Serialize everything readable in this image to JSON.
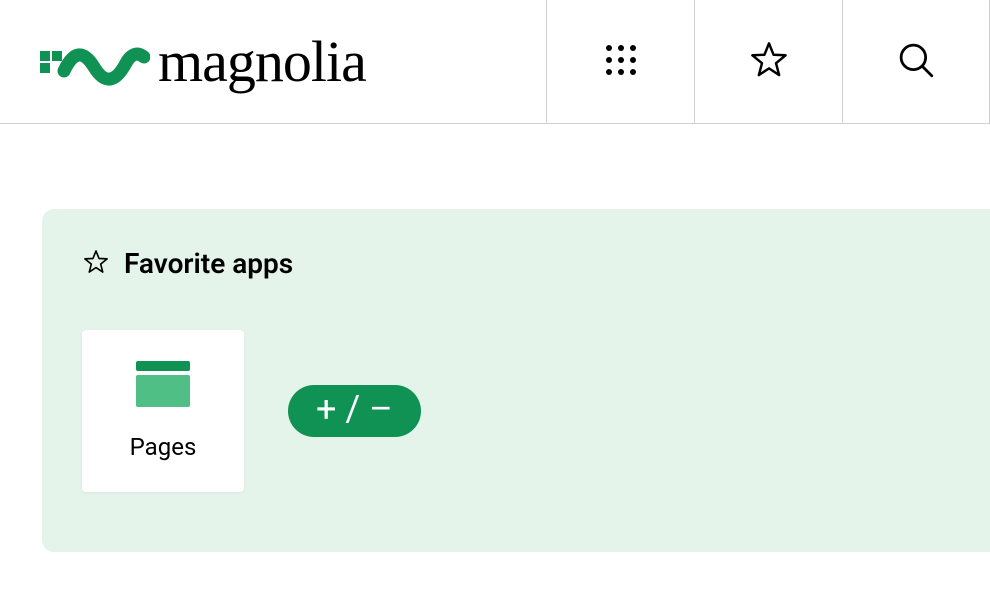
{
  "brand": {
    "name": "magnolia"
  },
  "favorites": {
    "title": "Favorite apps",
    "apps": [
      {
        "label": "Pages"
      }
    ],
    "add_remove_label": "+ / –"
  },
  "colors": {
    "accent": "#0f9253",
    "panel_bg": "#e4f4eb"
  }
}
